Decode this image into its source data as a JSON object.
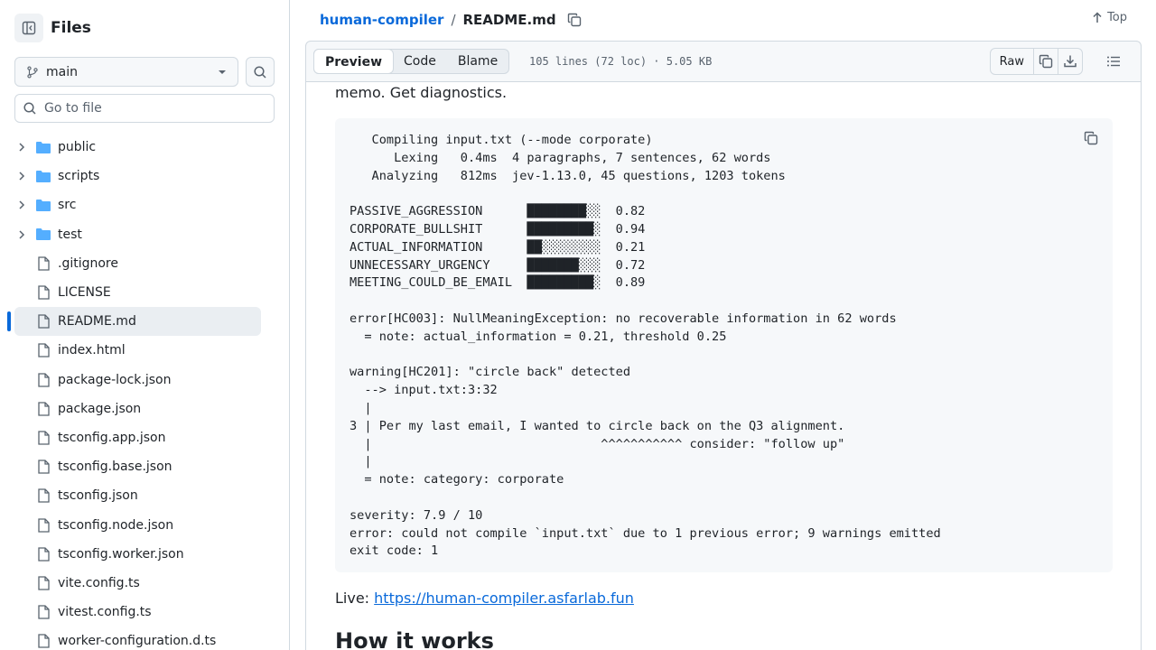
{
  "sidebar": {
    "title": "Files",
    "branch": "main",
    "goto_placeholder": "Go to file",
    "items": [
      {
        "name": "public",
        "type": "folder"
      },
      {
        "name": "scripts",
        "type": "folder"
      },
      {
        "name": "src",
        "type": "folder"
      },
      {
        "name": "test",
        "type": "folder"
      },
      {
        "name": ".gitignore",
        "type": "file"
      },
      {
        "name": "LICENSE",
        "type": "file"
      },
      {
        "name": "README.md",
        "type": "file",
        "active": true
      },
      {
        "name": "index.html",
        "type": "file"
      },
      {
        "name": "package-lock.json",
        "type": "file"
      },
      {
        "name": "package.json",
        "type": "file"
      },
      {
        "name": "tsconfig.app.json",
        "type": "file"
      },
      {
        "name": "tsconfig.base.json",
        "type": "file"
      },
      {
        "name": "tsconfig.json",
        "type": "file"
      },
      {
        "name": "tsconfig.node.json",
        "type": "file"
      },
      {
        "name": "tsconfig.worker.json",
        "type": "file"
      },
      {
        "name": "vite.config.ts",
        "type": "file"
      },
      {
        "name": "vitest.config.ts",
        "type": "file"
      },
      {
        "name": "worker-configuration.d.ts",
        "type": "file"
      }
    ]
  },
  "header": {
    "repo": "human-compiler",
    "separator": "/",
    "file": "README.md",
    "top_label": "Top"
  },
  "file_bar": {
    "tabs": [
      "Preview",
      "Code",
      "Blame"
    ],
    "active_tab": "Preview",
    "meta": "105 lines (72 loc) · 5.05 KB",
    "raw_label": "Raw"
  },
  "content": {
    "intro": "memo. Get diagnostics.",
    "code": "   Compiling input.txt (--mode corporate)\n      Lexing   0.4ms  4 paragraphs, 7 sentences, 62 words\n   Analyzing   812ms  jev-1.13.0, 45 questions, 1203 tokens\n\nPASSIVE_AGGRESSION      ████████░░  0.82\nCORPORATE_BULLSHIT      █████████░  0.94\nACTUAL_INFORMATION      ██░░░░░░░░  0.21\nUNNECESSARY_URGENCY     ███████░░░  0.72\nMEETING_COULD_BE_EMAIL  █████████░  0.89\n\nerror[HC003]: NullMeaningException: no recoverable information in 62 words\n  = note: actual_information = 0.21, threshold 0.25\n\nwarning[HC201]: \"circle back\" detected\n  --> input.txt:3:32\n  |\n3 | Per my last email, I wanted to circle back on the Q3 alignment.\n  |                               ^^^^^^^^^^^ consider: \"follow up\"\n  |\n  = note: category: corporate\n\nseverity: 7.9 / 10\nerror: could not compile `input.txt` due to 1 previous error; 9 warnings emitted\nexit code: 1",
    "live_label": "Live:",
    "live_url": "https://human-compiler.asfarlab.fun",
    "heading": "How it works"
  },
  "colors": {
    "link": "#0969da",
    "folder": "#54aeff",
    "border": "#d1d9e0",
    "muted": "#59636e"
  }
}
